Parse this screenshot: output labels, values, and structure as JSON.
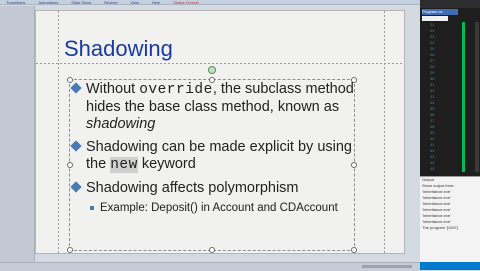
{
  "window": {
    "ribbon_tabs": [
      "Transitions",
      "Animations",
      "Slide Show",
      "Review",
      "View",
      "Help",
      "Shape Format"
    ]
  },
  "slide": {
    "title": "Shadowing",
    "bullets": [
      {
        "pre": "Without ",
        "code": "override",
        "post": ", the subclass method hides the base class method, known as ",
        "italic": "shadowing"
      },
      {
        "pre": "Shadowing can be made explicit by using the ",
        "code": "new",
        "post": " keyword"
      },
      {
        "text": "Shadowing affects polymorphism"
      }
    ],
    "sub_bullet": "Example: Deposit() in Account and CDAccount"
  },
  "ide": {
    "tab_label": "Program.cs",
    "line_numbers": [
      "21",
      "22",
      "23",
      "24",
      "25",
      "26",
      "27",
      "28",
      "29",
      "30",
      "31",
      "32",
      "33",
      "34",
      "35",
      "36",
      "37",
      "38",
      "39",
      "40",
      "41",
      "42",
      "43",
      "44",
      "45"
    ],
    "output_header": "Output",
    "output_lines": [
      "Show output from:",
      "'Inheritance.exe'",
      "'Inheritance.exe'",
      "'Inheritance.exe'",
      "'Inheritance.exe'",
      "'Inheritance.exe'",
      "'Inheritance.exe'",
      "The program '[1097]"
    ]
  },
  "colors": {
    "title": "#1a3aa0",
    "bullet": "#4a7ab5"
  }
}
